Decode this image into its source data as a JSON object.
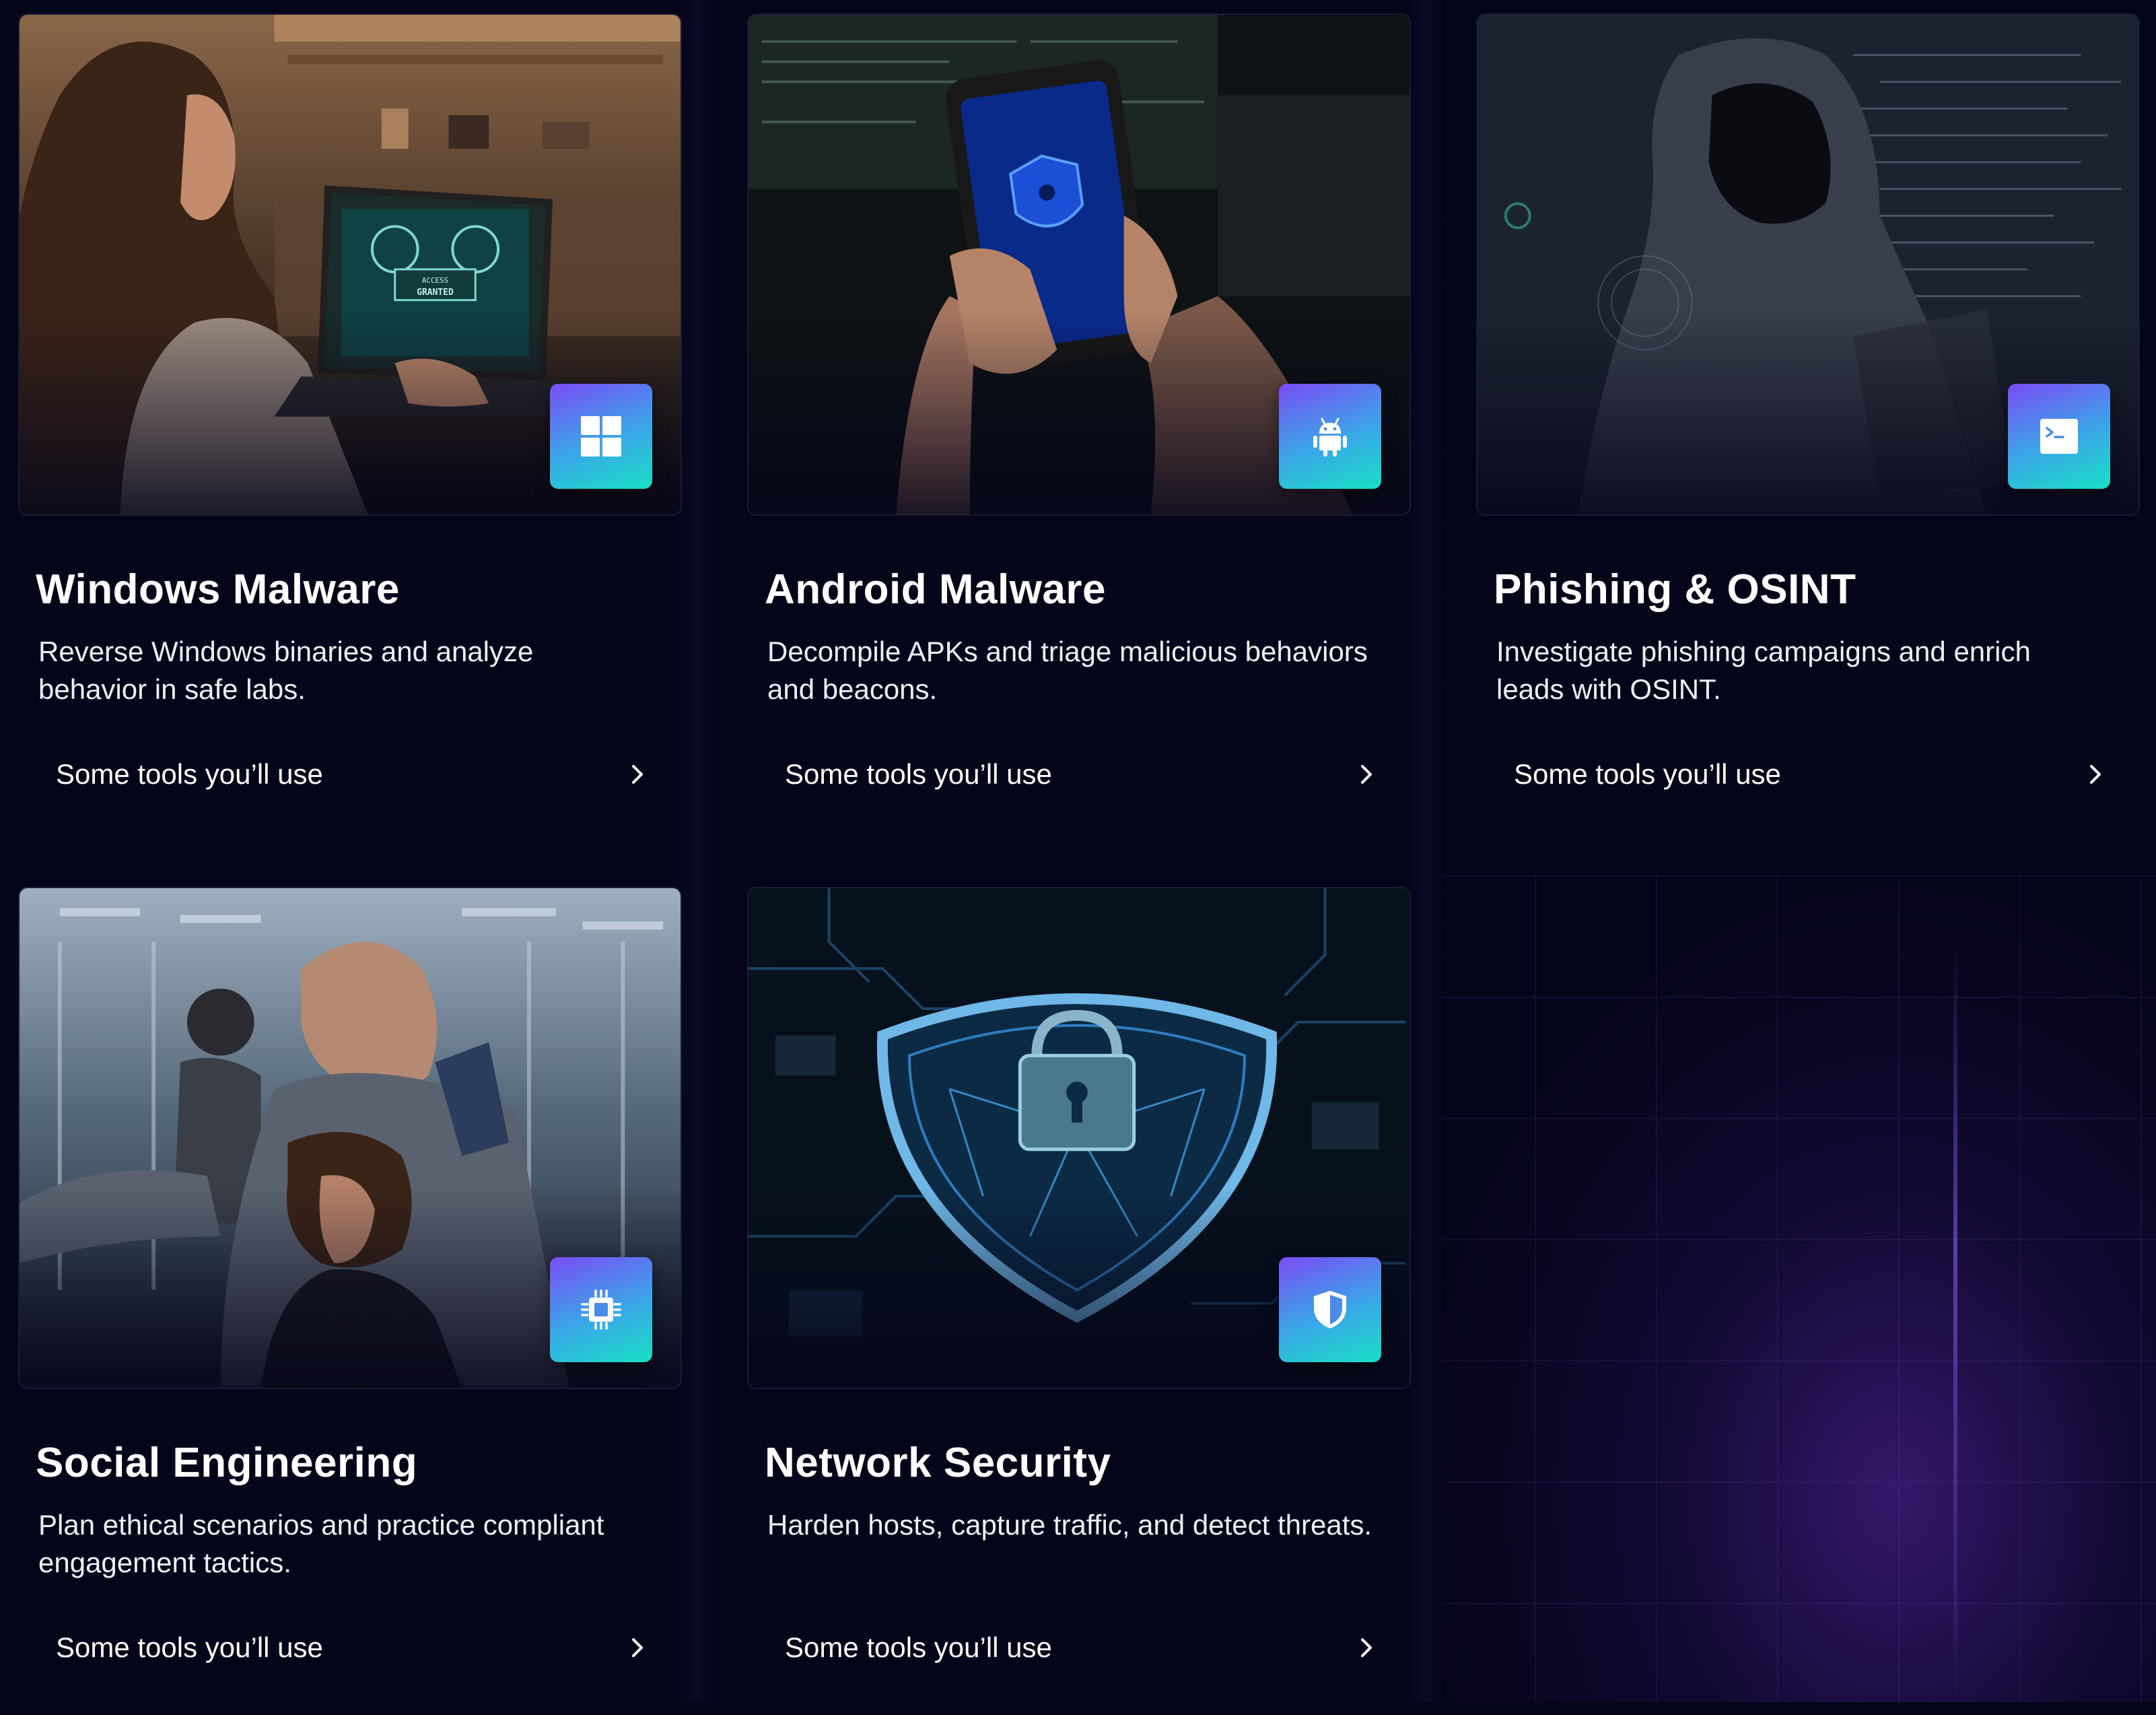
{
  "cards": [
    {
      "title": "Windows Malware",
      "description": "Reverse Windows binaries and analyze behavior in safe labs.",
      "tools_label": "Some tools you’ll use",
      "icon": "windows-icon",
      "photo_words": [
        "ACCESS",
        "GRANTED"
      ]
    },
    {
      "title": "Android Malware",
      "description": "Decompile APKs and triage malicious behaviors and beacons.",
      "tools_label": "Some tools you’ll use",
      "icon": "android-icon"
    },
    {
      "title": "Phishing & OSINT",
      "description": "Investigate phishing campaigns and enrich leads with OSINT.",
      "tools_label": "Some tools you’ll use",
      "icon": "terminal-icon"
    },
    {
      "title": "Social Engineering",
      "description": "Plan ethical scenarios and practice compliant engagement tactics.",
      "tools_label": "Some tools you’ll use",
      "icon": "chip-icon"
    },
    {
      "title": "Network Security",
      "description": "Harden hosts, capture traffic, and detect threats.",
      "tools_label": "Some tools you’ll use",
      "icon": "shield-icon"
    }
  ],
  "colors": {
    "background": "#05051a",
    "badge_gradient_start": "#7a4cf5",
    "badge_gradient_end": "#18e0c4",
    "text": "#ffffff"
  }
}
